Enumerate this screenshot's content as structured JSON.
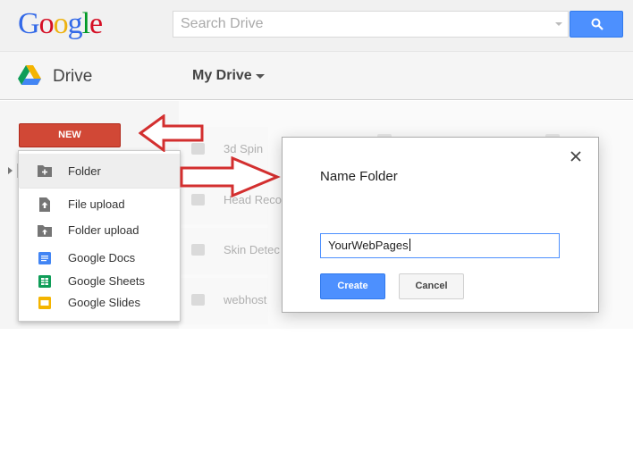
{
  "header": {
    "logo_letters": [
      "G",
      "o",
      "o",
      "g",
      "l",
      "e"
    ],
    "logo_colors": [
      "#3369e8",
      "#d50f25",
      "#eeb211",
      "#3369e8",
      "#009925",
      "#d50f25"
    ],
    "search_placeholder": "Search Drive"
  },
  "subheader": {
    "app_title": "Drive",
    "location": "My Drive"
  },
  "sidebar": {
    "new_label": "NEW"
  },
  "new_menu": {
    "items": [
      {
        "label": "Folder",
        "icon": "folder-add-icon"
      },
      {
        "label": "File upload",
        "icon": "file-upload-icon"
      },
      {
        "label": "Folder upload",
        "icon": "folder-upload-icon"
      },
      {
        "label": "Google Docs",
        "icon": "docs-icon",
        "color": "#4285f4"
      },
      {
        "label": "Google Sheets",
        "icon": "sheets-icon",
        "color": "#0f9d58"
      },
      {
        "label": "Google Slides",
        "icon": "slides-icon",
        "color": "#f4b400"
      }
    ]
  },
  "files": [
    {
      "name": "3d Spin"
    },
    {
      "name": "Head Reco"
    },
    {
      "name": "Skin Detec"
    },
    {
      "name": "webhost"
    }
  ],
  "dialog": {
    "title": "Name Folder",
    "input_value": "YourWebPages",
    "create_label": "Create",
    "cancel_label": "Cancel"
  },
  "colors": {
    "accent_blue": "#4d90fe",
    "new_button_red": "#d14836",
    "annotation_arrow": "#d32f2f"
  }
}
